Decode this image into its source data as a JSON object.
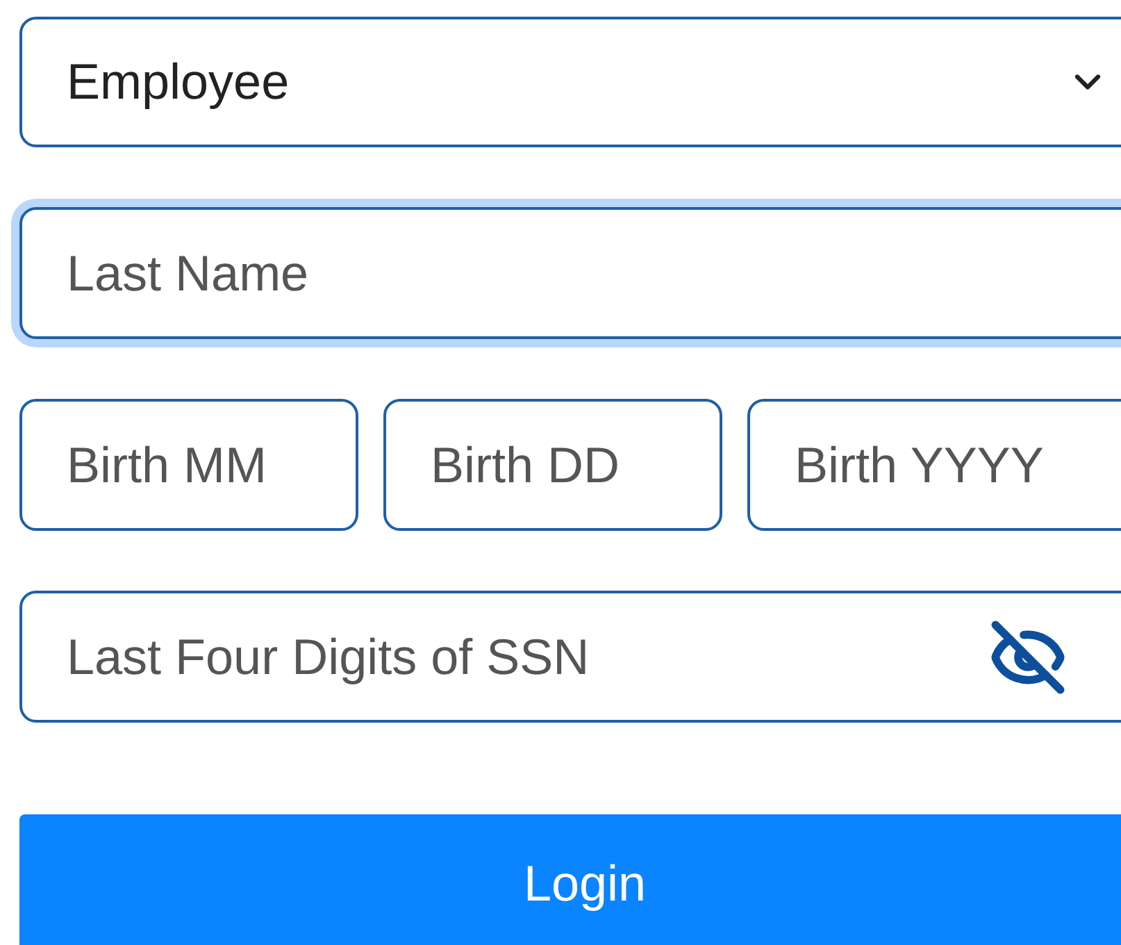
{
  "role_select": {
    "value": "Employee"
  },
  "fields": [
    {
      "placeholder": "Last Name",
      "focused": true
    }
  ],
  "birth_fields": [
    {
      "placeholder": "Birth MM"
    },
    {
      "placeholder": "Birth DD"
    },
    {
      "placeholder": "Birth YYYY"
    }
  ],
  "ssn_field": {
    "placeholder": "Last Four Digits of SSN",
    "hidden": true
  },
  "login_button": {
    "label": "Login"
  }
}
